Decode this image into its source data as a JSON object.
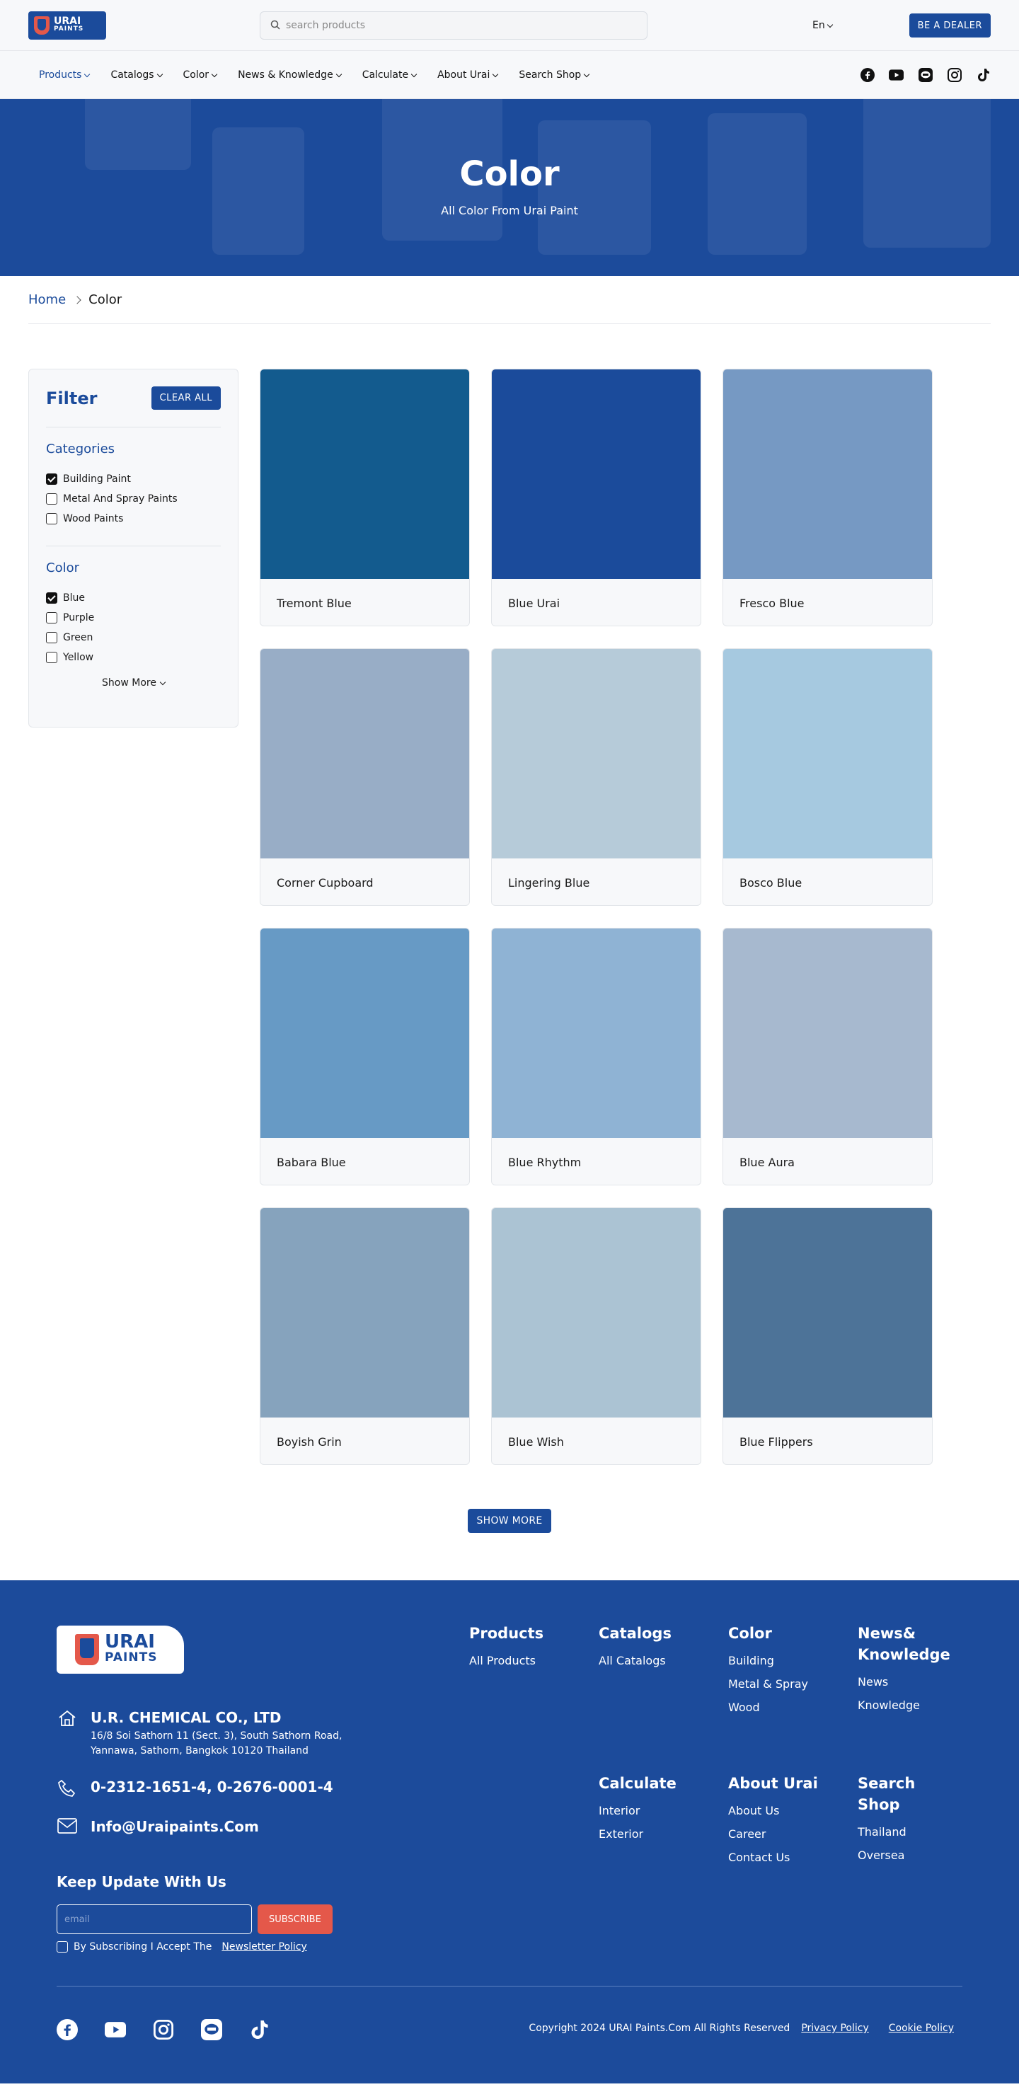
{
  "brand": {
    "logo_top": "URAI",
    "logo_bottom": "PAINTS",
    "accent": "#1b4b9b",
    "accent2": "#e4584a"
  },
  "header": {
    "search_placeholder": "search products",
    "lang": "En",
    "dealer_label": "BE A DEALER"
  },
  "nav": {
    "items": [
      {
        "label": "Products"
      },
      {
        "label": "Catalogs"
      },
      {
        "label": "Color"
      },
      {
        "label": "News & Knowledge"
      },
      {
        "label": "Calculate"
      },
      {
        "label": "About Urai"
      },
      {
        "label": "Search Shop"
      }
    ],
    "socials": [
      "facebook-icon",
      "youtube-icon",
      "line-icon",
      "instagram-icon",
      "tiktok-icon"
    ]
  },
  "hero": {
    "title": "Color",
    "subtitle": "All Color From Urai Paint"
  },
  "breadcrumb": {
    "home": "Home",
    "current": "Color"
  },
  "filter": {
    "title": "Filter",
    "clear_label": "CLEAR ALL",
    "categories_title": "Categories",
    "categories": [
      {
        "label": "Building Paint",
        "checked": true
      },
      {
        "label": "Metal And Spray Paints",
        "checked": false
      },
      {
        "label": "Wood Paints",
        "checked": false
      }
    ],
    "color_title": "Color",
    "colors": [
      {
        "label": "Blue",
        "checked": true
      },
      {
        "label": "Purple",
        "checked": false
      },
      {
        "label": "Green",
        "checked": false
      },
      {
        "label": "Yellow",
        "checked": false
      }
    ],
    "show_more": "Show More"
  },
  "colors": [
    {
      "name": "Tremont Blue",
      "hex": "#135b8e"
    },
    {
      "name": "Blue Urai",
      "hex": "#1b4b9b"
    },
    {
      "name": "Fresco Blue",
      "hex": "#7699c3"
    },
    {
      "name": "Corner Cupboard",
      "hex": "#98adc6"
    },
    {
      "name": "Lingering Blue",
      "hex": "#b6cbd9"
    },
    {
      "name": "Bosco Blue",
      "hex": "#a6c9e0"
    },
    {
      "name": "Babara Blue",
      "hex": "#679ac5"
    },
    {
      "name": "Blue Rhythm",
      "hex": "#8fb3d4"
    },
    {
      "name": "Blue Aura",
      "hex": "#a7b9cf"
    },
    {
      "name": "Boyish Grin",
      "hex": "#86a3bd"
    },
    {
      "name": "Blue Wish",
      "hex": "#abc3d3"
    },
    {
      "name": "Blue Flippers",
      "hex": "#4d7398"
    }
  ],
  "show_more_button": "SHOW MORE",
  "footer": {
    "company": "U.R. CHEMICAL CO., LTD",
    "address_line1": "16/8 Soi Sathorn 11 (Sect. 3), South Sathorn Road,",
    "address_line2": "Yannawa, Sathorn, Bangkok 10120 Thailand",
    "phone": "0-2312-1651-4, 0-2676-0001-4",
    "email": "Info@Uraipaints.Com",
    "keep_update": "Keep Update With Us",
    "email_placeholder": "email",
    "subscribe": "SUBSCRIBE",
    "accept_text": "By Subscribing I Accept The",
    "newsletter_policy": "Newsletter Policy",
    "columns": [
      {
        "title": "Products",
        "links": [
          "All Products"
        ]
      },
      {
        "title": "Catalogs",
        "links": [
          "All Catalogs"
        ]
      },
      {
        "title": "Color",
        "links": [
          "Building",
          "Metal & Spray",
          "Wood"
        ]
      },
      {
        "title": "News& Knowledge",
        "links": [
          "News",
          "Knowledge"
        ]
      },
      {
        "title": "Calculate",
        "links": [
          "Interior",
          "Exterior"
        ]
      },
      {
        "title": "About Urai",
        "links": [
          "About Us",
          "Career",
          "Contact Us"
        ]
      },
      {
        "title": "Search Shop",
        "links": [
          "Thailand",
          "Oversea"
        ]
      }
    ],
    "copyright": "Copyright 2024 URAI Paints.Com All Rights Reserved",
    "privacy": "Privacy Policy",
    "cookie": "Cookie Policy"
  }
}
